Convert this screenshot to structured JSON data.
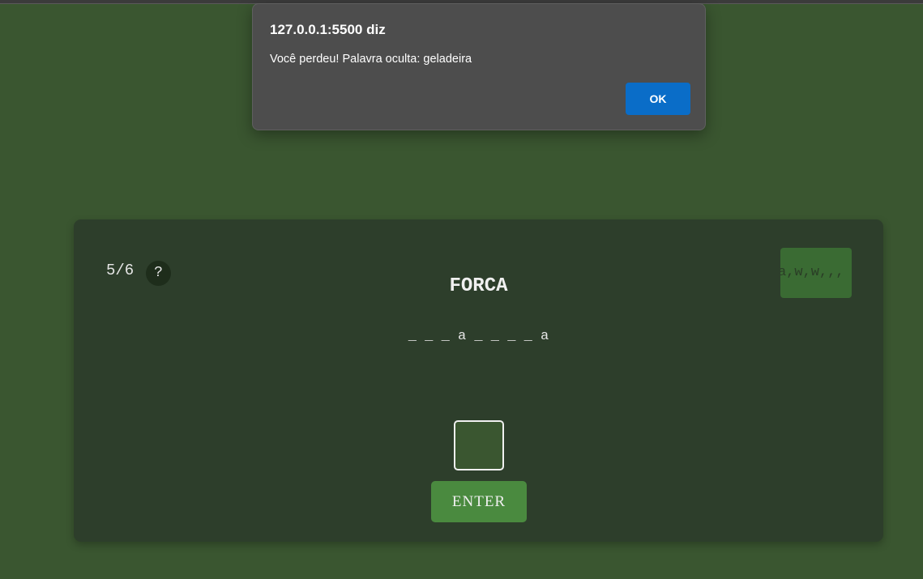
{
  "alert": {
    "origin": "127.0.0.1:5500 diz",
    "message": "Você perdeu! Palavra oculta: geladeira",
    "ok_label": "OK"
  },
  "game": {
    "counter": "5/6",
    "help_label": "?",
    "title": "FORCA",
    "used_letters": "a,w,w,,,",
    "word_display": "_ _ _ a _ _ _ _ a",
    "input_value": "",
    "enter_label": "ENTER"
  },
  "colors": {
    "background": "#3a5630",
    "card": "#2d3e2b",
    "accent_button": "#4a8a3f",
    "dialog_ok": "#0a6dc8"
  }
}
